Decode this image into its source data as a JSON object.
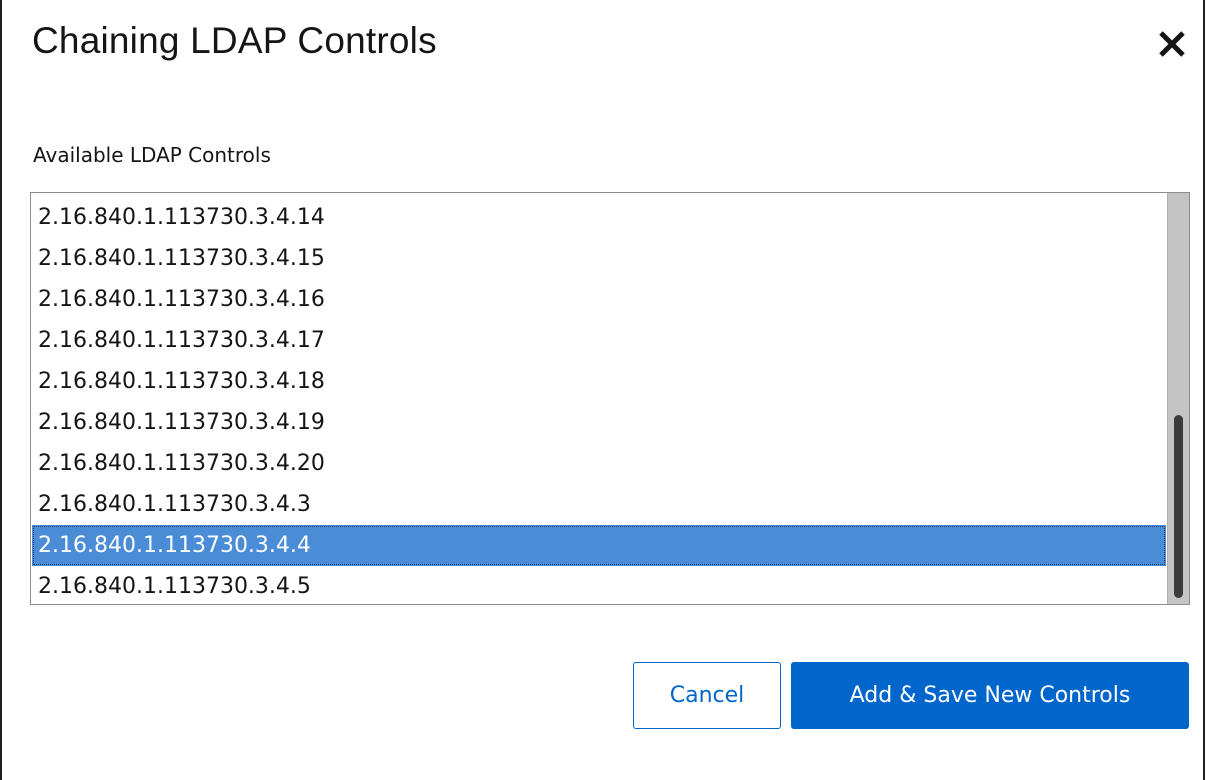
{
  "dialog": {
    "title": "Chaining LDAP Controls",
    "close_icon": "close-icon"
  },
  "field": {
    "label": "Available LDAP Controls"
  },
  "controls_list": {
    "items": [
      "2.16.840.1.113730.3.4.14",
      "2.16.840.1.113730.3.4.15",
      "2.16.840.1.113730.3.4.16",
      "2.16.840.1.113730.3.4.17",
      "2.16.840.1.113730.3.4.18",
      "2.16.840.1.113730.3.4.19",
      "2.16.840.1.113730.3.4.20",
      "2.16.840.1.113730.3.4.3",
      "2.16.840.1.113730.3.4.4",
      "2.16.840.1.113730.3.4.5"
    ],
    "selected": "2.16.840.1.113730.3.4.4",
    "selection_color": "#4a8cd6"
  },
  "footer": {
    "cancel_label": "Cancel",
    "save_label": "Add & Save New Controls",
    "primary_color": "#0066cc"
  }
}
